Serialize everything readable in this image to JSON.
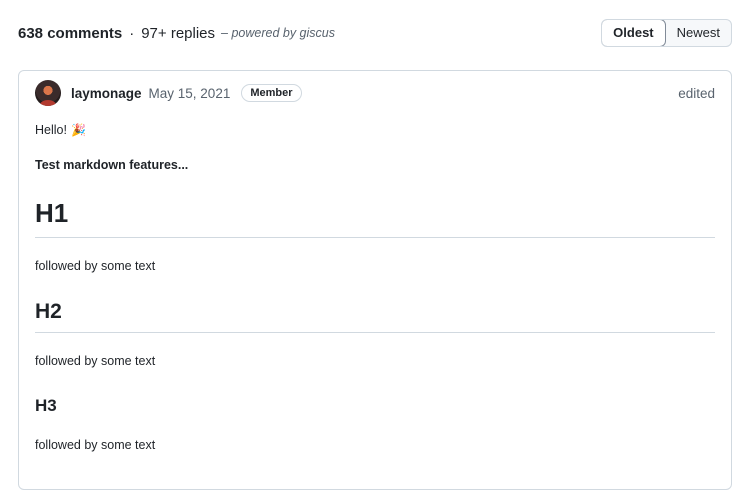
{
  "header": {
    "comment_count": "638 comments",
    "separator": "·",
    "reply_count": "97+ replies",
    "powered_by": "– powered by giscus"
  },
  "sort": {
    "options": [
      "Oldest",
      "Newest"
    ],
    "selected": "Oldest"
  },
  "comment": {
    "author": "laymonage",
    "date": "May 15, 2021",
    "role_badge": "Member",
    "edited_label": "edited",
    "body": {
      "greeting": "Hello!",
      "emoji": "🎉",
      "intro": "Test markdown features...",
      "h1": "H1",
      "h1_text": "followed by some text",
      "h2": "H2",
      "h2_text": "followed by some text",
      "h3": "H3",
      "h3_text": "followed by some text"
    }
  },
  "colors": {
    "text": "#1f2328",
    "muted": "#59636e",
    "border": "#d1d9e0"
  }
}
